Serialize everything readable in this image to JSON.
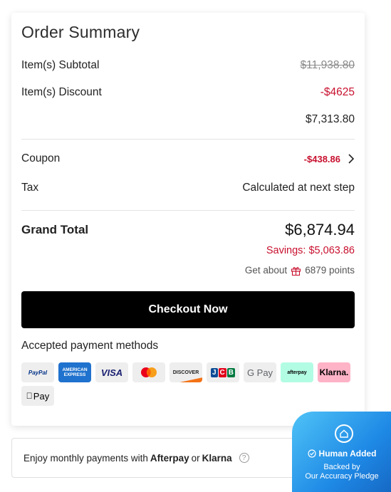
{
  "summary": {
    "title": "Order Summary",
    "subtotal_label": "Item(s) Subtotal",
    "subtotal_value": "$11,938.80",
    "discount_label": "Item(s) Discount",
    "discount_value": "-$4625",
    "after_discount_value": "$7,313.80",
    "coupon_label": "Coupon",
    "coupon_value": "-$438.86",
    "tax_label": "Tax",
    "tax_value": "Calculated at next step",
    "grand_total_label": "Grand Total",
    "grand_total_value": "$6,874.94",
    "savings": "Savings: $5,063.86",
    "points_prefix": "Get about",
    "points_value": "6879 points",
    "checkout_label": "Checkout Now",
    "payment_methods_label": "Accepted payment methods"
  },
  "payment_methods": {
    "paypal": "PayPal",
    "amex": "AMERICAN EXPRESS",
    "visa": "VISA",
    "mastercard": "mastercard-logo",
    "discover": "DISCOVER",
    "jcb": "JCB",
    "gpay": "G Pay",
    "afterpay": "afterpay",
    "klarna": "Klarna.",
    "applepay": "Pay"
  },
  "financing": {
    "prefix": "Enjoy monthly payments with",
    "afterpay": "Afterpay",
    "or": "or",
    "klarna": "Klarna",
    "help": "?"
  },
  "badge": {
    "title": "Human Added",
    "line1": "Backed by",
    "line2": "Our Accuracy Pledge"
  },
  "colors": {
    "accent_red": "#c8102e",
    "checkout_bg": "#000000",
    "badge_blue": "#1e88e5"
  }
}
